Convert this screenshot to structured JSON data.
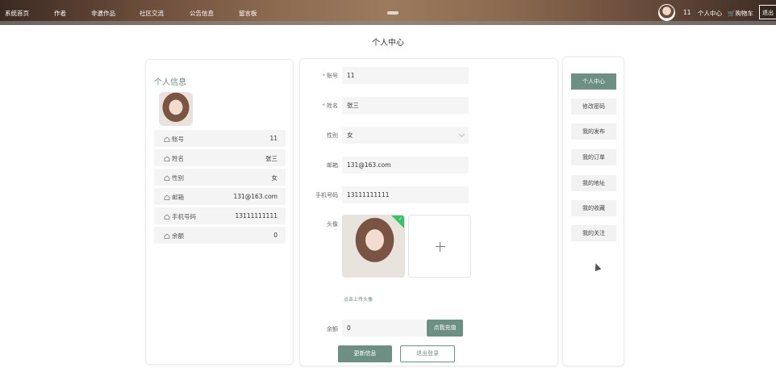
{
  "nav": {
    "items": [
      "系统首页",
      "作者",
      "非遗作品",
      "社区交流",
      "公告信息",
      "留言板"
    ],
    "user": "11",
    "personal_center": "个人中心",
    "cart": "购物车",
    "logout": "退出"
  },
  "page_title": "个人中心",
  "profile": {
    "title": "个人信息",
    "rows": [
      {
        "label": "账号",
        "value": "11"
      },
      {
        "label": "姓名",
        "value": "张三"
      },
      {
        "label": "性别",
        "value": "女"
      },
      {
        "label": "邮箱",
        "value": "131@163.com"
      },
      {
        "label": "手机号码",
        "value": "13111111111"
      },
      {
        "label": "余额",
        "value": "0"
      }
    ]
  },
  "form": {
    "account_label": "账号",
    "account_value": "11",
    "name_label": "姓名",
    "name_value": "张三",
    "gender_label": "性别",
    "gender_value": "女",
    "email_label": "邮箱",
    "email_value": "131@163.com",
    "phone_label": "手机号码",
    "phone_value": "13111111111",
    "avatar_label": "头像",
    "upload_hint": "点击上传头像",
    "balance_label": "余额",
    "balance_value": "0",
    "recharge_button": "点我充值",
    "update_button": "更新信息",
    "logout_button": "退出登录"
  },
  "side_menu": [
    "个人中心",
    "修改密码",
    "我的发布",
    "我的订单",
    "我的地址",
    "我的收藏",
    "我的关注"
  ],
  "colors": {
    "accent": "#6e8f83"
  }
}
